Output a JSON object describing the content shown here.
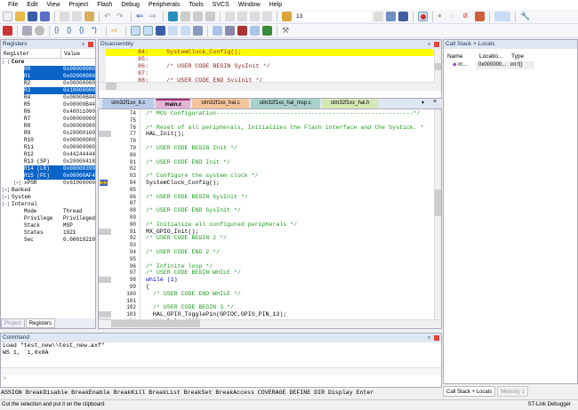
{
  "menu": [
    "File",
    "Edit",
    "View",
    "Project",
    "Flash",
    "Debug",
    "Peripherals",
    "Tools",
    "SVCS",
    "Window",
    "Help"
  ],
  "toolbar": {
    "find_value": "13"
  },
  "registers": {
    "title": "Registers",
    "col_register": "Register",
    "col_value": "Value",
    "rows": [
      {
        "n": "Core",
        "v": "",
        "lvl": 0,
        "sel": false,
        "bold": true,
        "exp": "-"
      },
      {
        "n": "R0",
        "v": "0x00000000",
        "lvl": 2,
        "sel": true
      },
      {
        "n": "R1",
        "v": "0x02000000",
        "lvl": 2,
        "sel": true
      },
      {
        "n": "R2",
        "v": "0x00000000",
        "lvl": 2,
        "sel": false
      },
      {
        "n": "R3",
        "v": "0x10000000",
        "lvl": 2,
        "sel": true
      },
      {
        "n": "R4",
        "v": "0x08000B44",
        "lvl": 2,
        "sel": false
      },
      {
        "n": "R5",
        "v": "0x08000B44",
        "lvl": 2,
        "sel": false
      },
      {
        "n": "R6",
        "v": "0x40011000",
        "lvl": 2,
        "sel": false
      },
      {
        "n": "R7",
        "v": "0x00000000",
        "lvl": 2,
        "sel": false
      },
      {
        "n": "R8",
        "v": "0x00000000",
        "lvl": 2,
        "sel": false
      },
      {
        "n": "R9",
        "v": "0x20000160",
        "lvl": 2,
        "sel": false
      },
      {
        "n": "R10",
        "v": "0x00000000",
        "lvl": 2,
        "sel": false
      },
      {
        "n": "R11",
        "v": "0x00000000",
        "lvl": 2,
        "sel": false
      },
      {
        "n": "R12",
        "v": "0x44244444",
        "lvl": 2,
        "sel": false
      },
      {
        "n": "R13 (SP)",
        "v": "0x20000418",
        "lvl": 2,
        "sel": false
      },
      {
        "n": "R14 (LR)",
        "v": "0x08000399",
        "lvl": 2,
        "sel": true
      },
      {
        "n": "R15 (PC)",
        "v": "0x08000AF4",
        "lvl": 2,
        "sel": true
      },
      {
        "n": "xPSR",
        "v": "0x61000000",
        "lvl": 2,
        "sel": false,
        "exp": "+"
      },
      {
        "n": "Banked",
        "v": "",
        "lvl": 0,
        "sel": false,
        "exp": "+"
      },
      {
        "n": "System",
        "v": "",
        "lvl": 0,
        "sel": false,
        "exp": "+"
      },
      {
        "n": "Internal",
        "v": "",
        "lvl": 0,
        "sel": false,
        "exp": "-"
      },
      {
        "n": "Mode",
        "v": "Thread",
        "lvl": 1,
        "sel": false
      },
      {
        "n": "Privilege",
        "v": "Privileged",
        "lvl": 1,
        "sel": false
      },
      {
        "n": "Stack",
        "v": "MSP",
        "lvl": 1,
        "sel": false
      },
      {
        "n": "States",
        "v": "1921",
        "lvl": 1,
        "sel": false
      },
      {
        "n": "Sec",
        "v": "0.00019210",
        "lvl": 1,
        "sel": false
      }
    ],
    "tabs": [
      "Project",
      "Registers"
    ]
  },
  "disassembly": {
    "title": "Disassembly",
    "lines": [
      {
        "t": "   84:     SystemClock_Config();",
        "cur": true
      },
      {
        "t": "   85: ",
        "cur": false
      },
      {
        "t": "   86:     /* USER CODE BEGIN SysInit */",
        "cur": false
      },
      {
        "t": "   87: ",
        "cur": false
      },
      {
        "t": "   88:     /* USER CODE END SysInit */",
        "cur": false
      }
    ]
  },
  "file_tabs": [
    {
      "label": "stm32f1xx_it.c",
      "color": "#b9cbe6"
    },
    {
      "label": "main.c",
      "color": "#e4b3d6"
    },
    {
      "label": "stm32f1xx_hal.c",
      "color": "#f5c49a"
    },
    {
      "label": "stm32f1xx_hal_msp.c",
      "color": "#a8d2cc"
    },
    {
      "label": "stm32f1xx_hal.h",
      "color": "#d6e6b5"
    }
  ],
  "code": [
    {
      "n": "74",
      "t": "/* MCU Configuration--------------------------------------------------------*/",
      "c": "com"
    },
    {
      "n": "75",
      "t": "",
      "c": "code"
    },
    {
      "n": "76",
      "t": "/* Reset of all peripherals, Initializes the Flash interface and the Systick. *",
      "c": "com"
    },
    {
      "n": "77",
      "t": "HAL_Init();",
      "c": "code",
      "g": true
    },
    {
      "n": "78",
      "t": "",
      "c": "code"
    },
    {
      "n": "79",
      "t": "/* USER CODE BEGIN Init */",
      "c": "com"
    },
    {
      "n": "80",
      "t": "",
      "c": "code"
    },
    {
      "n": "81",
      "t": "/* USER CODE END Init */",
      "c": "com"
    },
    {
      "n": "82",
      "t": "",
      "c": "code"
    },
    {
      "n": "83",
      "t": "/* Configure the system clock */",
      "c": "com"
    },
    {
      "n": "84",
      "t": "SystemClock_Config();",
      "c": "code",
      "pc": true
    },
    {
      "n": "85",
      "t": "",
      "c": "code"
    },
    {
      "n": "86",
      "t": "/* USER CODE BEGIN SysInit */",
      "c": "com"
    },
    {
      "n": "87",
      "t": "",
      "c": "code"
    },
    {
      "n": "88",
      "t": "/* USER CODE END SysInit */",
      "c": "com"
    },
    {
      "n": "89",
      "t": "",
      "c": "code"
    },
    {
      "n": "90",
      "t": "/* Initialize all configured peripherals */",
      "c": "com"
    },
    {
      "n": "91",
      "t": "MX_GPIO_Init();",
      "c": "code",
      "g": true
    },
    {
      "n": "92",
      "t": "/* USER CODE BEGIN 2 */",
      "c": "com"
    },
    {
      "n": "93",
      "t": "",
      "c": "code"
    },
    {
      "n": "94",
      "t": "/* USER CODE END 2 */",
      "c": "com"
    },
    {
      "n": "95",
      "t": "",
      "c": "code"
    },
    {
      "n": "96",
      "t": "/* Infinite loop */",
      "c": "com"
    },
    {
      "n": "97",
      "t": "/* USER CODE BEGIN WHILE */",
      "c": "com"
    },
    {
      "n": "98",
      "t": "while (1)",
      "c": "kw",
      "g": true
    },
    {
      "n": "99",
      "t": "{",
      "c": "code"
    },
    {
      "n": "100",
      "t": "  /* USER CODE END WHILE */",
      "c": "com"
    },
    {
      "n": "101",
      "t": "",
      "c": "code"
    },
    {
      "n": "102",
      "t": "  /* USER CODE BEGIN 3 */",
      "c": "com"
    },
    {
      "n": "103",
      "t": "  HAL_GPIO_TogglePin(GPIOC,GPIO_PIN_13);",
      "c": "code",
      "g": true
    },
    {
      "n": "104",
      "t": "  HAL_Delay(200);",
      "c": "code",
      "g": true
    }
  ],
  "callstack": {
    "title": "Call Stack + Locals",
    "cols": [
      "Name",
      "Locatio...",
      "Type"
    ],
    "row": [
      "m...",
      "0x000000...",
      "int f()"
    ],
    "tabs": [
      "Call Stack + Locals",
      "Memory 1"
    ]
  },
  "command": {
    "title": "Command",
    "lines": [
      "Load \"test_new\\\\test_new.axf\"",
      "WS 1, `i,0x0A"
    ],
    "prompt": ">",
    "help": "ASSIGN BreakDisable BreakEnable BreakKill BreakList BreakSet BreakAccess COVERAGE DEFINE DIR Display Enter"
  },
  "status": {
    "message": "Cut the selection and put it on the clipboard",
    "debugger": "ST-Link Debugger"
  }
}
